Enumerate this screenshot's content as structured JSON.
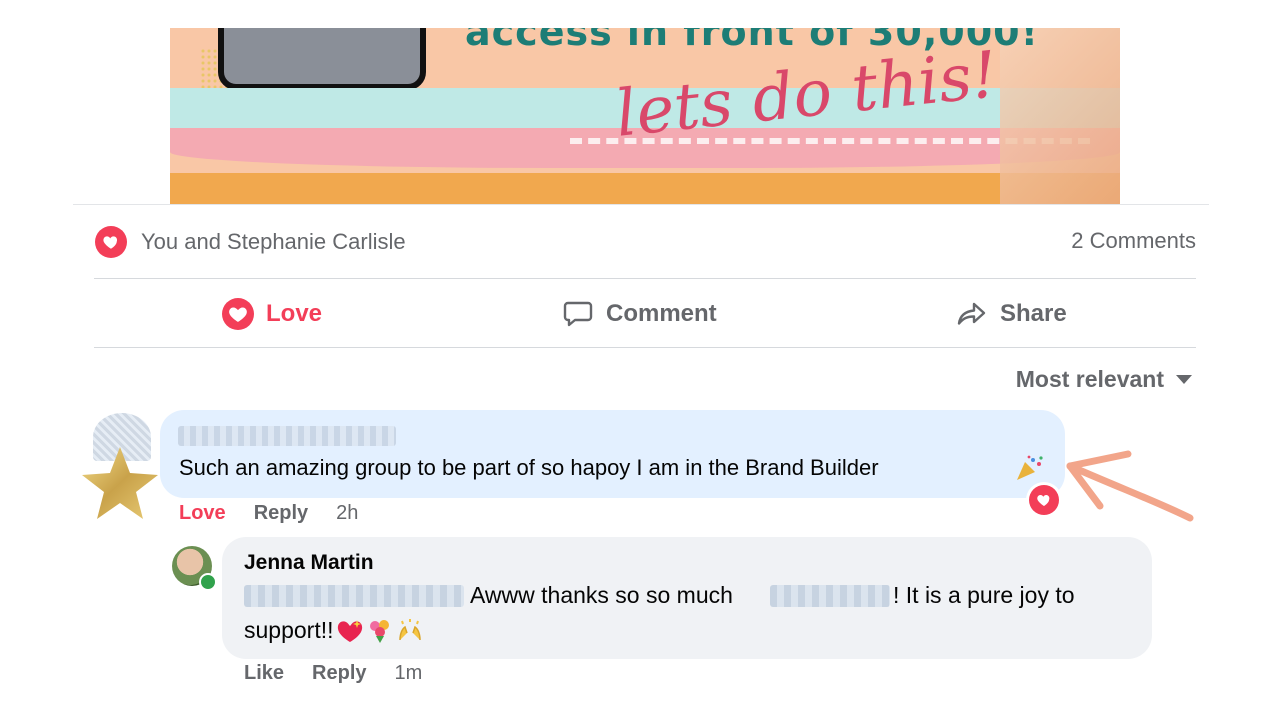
{
  "banner": {
    "headline": "access in front of 30,000!",
    "script": "lets do this!"
  },
  "reactions": {
    "summary": "You and Stephanie Carlisle",
    "comments_count": "2 Comments"
  },
  "actions": {
    "love": "Love",
    "comment": "Comment",
    "share": "Share"
  },
  "sort": {
    "label": "Most relevant"
  },
  "comment1": {
    "text": "Such an amazing group to be part of so hapoy I am in the Brand Builder",
    "love": "Love",
    "reply": "Reply",
    "time": "2h"
  },
  "reply1": {
    "author": "Jenna Martin",
    "text_part1": "Awww thanks so so much",
    "text_part2": "! It is a pure joy to",
    "text_part3": "support!!",
    "like": "Like",
    "reply": "Reply",
    "time": "1m"
  },
  "colors": {
    "love_red": "#f33e58",
    "muted": "#65676b",
    "bubble_blue": "#e3f0ff",
    "bubble_gray": "#f0f2f5"
  },
  "icons": {
    "reaction": "heart-icon",
    "comment": "speech-bubble-icon",
    "share": "share-arrow-icon",
    "sort": "caret-down-icon"
  }
}
